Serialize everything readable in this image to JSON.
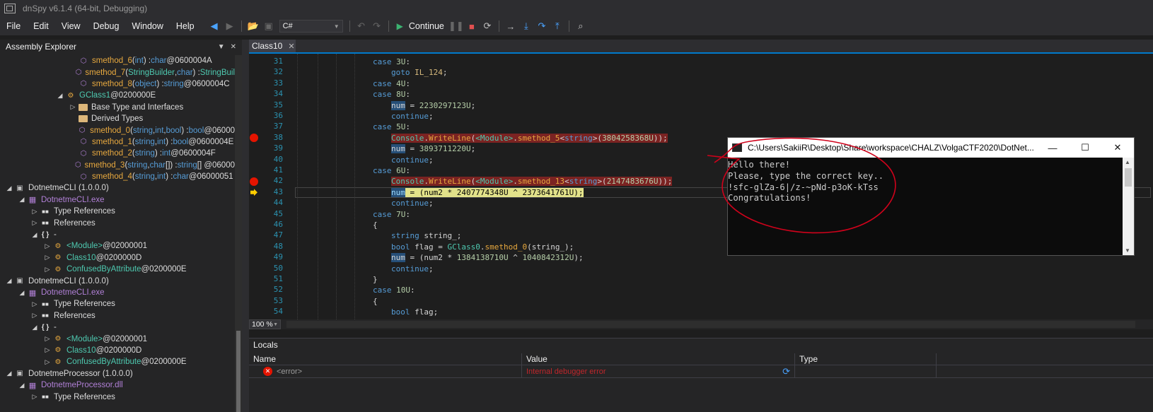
{
  "window": {
    "title": "dnSpy v6.1.4 (64-bit, Debugging)"
  },
  "menu": [
    "File",
    "Edit",
    "View",
    "Debug",
    "Window",
    "Help"
  ],
  "toolbar": {
    "language": "C#",
    "continue_label": "Continue"
  },
  "explorer": {
    "title": "Assembly Explorer",
    "rows": [
      {
        "indent": 5,
        "twisty": "",
        "icon": "method",
        "icon_name": "method-icon",
        "parts": [
          [
            "smethod_6",
            "c-method"
          ],
          [
            "(",
            "c-plain"
          ],
          [
            "int",
            "c-kw"
          ],
          [
            ") : ",
            "c-plain"
          ],
          [
            "char",
            "c-kw"
          ],
          [
            " @0600004A",
            "c-plain"
          ]
        ]
      },
      {
        "indent": 5,
        "twisty": "",
        "icon": "method",
        "icon_name": "method-icon",
        "parts": [
          [
            "smethod_7",
            "c-method"
          ],
          [
            "(",
            "c-plain"
          ],
          [
            "StringBuilder",
            "c-type"
          ],
          [
            ", ",
            "c-plain"
          ],
          [
            "char",
            "c-kw"
          ],
          [
            ") : ",
            "c-plain"
          ],
          [
            "StringBuil",
            "c-type"
          ]
        ]
      },
      {
        "indent": 5,
        "twisty": "",
        "icon": "method",
        "icon_name": "method-icon",
        "parts": [
          [
            "smethod_8",
            "c-method"
          ],
          [
            "(",
            "c-plain"
          ],
          [
            "object",
            "c-kw"
          ],
          [
            ") : ",
            "c-plain"
          ],
          [
            "string",
            "c-kw"
          ],
          [
            " @0600004C",
            "c-plain"
          ]
        ]
      },
      {
        "indent": 4,
        "twisty": "◢",
        "icon": "class",
        "icon_name": "class-icon",
        "parts": [
          [
            "GClass1",
            "c-type"
          ],
          [
            " @0200000E",
            "c-plain"
          ]
        ]
      },
      {
        "indent": 5,
        "twisty": "▷",
        "icon": "folder",
        "icon_name": "folder-icon",
        "parts": [
          [
            "Base Type and Interfaces",
            "c-plain"
          ]
        ]
      },
      {
        "indent": 5,
        "twisty": "",
        "icon": "folder",
        "icon_name": "folder-icon",
        "parts": [
          [
            "Derived Types",
            "c-plain"
          ]
        ]
      },
      {
        "indent": 5,
        "twisty": "",
        "icon": "method",
        "icon_name": "method-icon",
        "parts": [
          [
            "smethod_0",
            "c-method"
          ],
          [
            "(",
            "c-plain"
          ],
          [
            "string",
            "c-kw"
          ],
          [
            ", ",
            "c-plain"
          ],
          [
            "int",
            "c-kw"
          ],
          [
            ", ",
            "c-plain"
          ],
          [
            "bool",
            "c-kw"
          ],
          [
            ") : ",
            "c-plain"
          ],
          [
            "bool",
            "c-kw"
          ],
          [
            " @06000",
            "c-plain"
          ]
        ]
      },
      {
        "indent": 5,
        "twisty": "",
        "icon": "method",
        "icon_name": "method-icon",
        "parts": [
          [
            "smethod_1",
            "c-method"
          ],
          [
            "(",
            "c-plain"
          ],
          [
            "string",
            "c-kw"
          ],
          [
            ", ",
            "c-plain"
          ],
          [
            "int",
            "c-kw"
          ],
          [
            ") : ",
            "c-plain"
          ],
          [
            "bool",
            "c-kw"
          ],
          [
            " @0600004E",
            "c-plain"
          ]
        ]
      },
      {
        "indent": 5,
        "twisty": "",
        "icon": "method",
        "icon_name": "method-icon",
        "parts": [
          [
            "smethod_2",
            "c-method"
          ],
          [
            "(",
            "c-plain"
          ],
          [
            "string",
            "c-kw"
          ],
          [
            ") : ",
            "c-plain"
          ],
          [
            "int",
            "c-kw"
          ],
          [
            " @0600004F",
            "c-plain"
          ]
        ]
      },
      {
        "indent": 5,
        "twisty": "",
        "icon": "method",
        "icon_name": "method-icon",
        "parts": [
          [
            "smethod_3",
            "c-method"
          ],
          [
            "(",
            "c-plain"
          ],
          [
            "string",
            "c-kw"
          ],
          [
            ", ",
            "c-plain"
          ],
          [
            "char",
            "c-kw"
          ],
          [
            "[]) : ",
            "c-plain"
          ],
          [
            "string",
            "c-kw"
          ],
          [
            "[] @06000",
            "c-plain"
          ]
        ]
      },
      {
        "indent": 5,
        "twisty": "",
        "icon": "method",
        "icon_name": "method-icon",
        "parts": [
          [
            "smethod_4",
            "c-method"
          ],
          [
            "(",
            "c-plain"
          ],
          [
            "string",
            "c-kw"
          ],
          [
            ", ",
            "c-plain"
          ],
          [
            "int",
            "c-kw"
          ],
          [
            ") : ",
            "c-plain"
          ],
          [
            "char",
            "c-kw"
          ],
          [
            " @06000051",
            "c-plain"
          ]
        ]
      },
      {
        "indent": 0,
        "twisty": "◢",
        "icon": "asm",
        "icon_name": "assembly-icon",
        "parts": [
          [
            "DotnetmeCLI (1.0.0.0)",
            "c-plain"
          ]
        ]
      },
      {
        "indent": 1,
        "twisty": "◢",
        "icon": "module",
        "icon_name": "module-icon",
        "parts": [
          [
            "DotnetmeCLI.exe",
            "c-purple"
          ]
        ]
      },
      {
        "indent": 2,
        "twisty": "▷",
        "icon": "ref",
        "icon_name": "references-icon",
        "parts": [
          [
            "Type References",
            "c-plain"
          ]
        ]
      },
      {
        "indent": 2,
        "twisty": "▷",
        "icon": "ref",
        "icon_name": "references-icon",
        "parts": [
          [
            "References",
            "c-plain"
          ]
        ]
      },
      {
        "indent": 2,
        "twisty": "◢",
        "icon": "ns",
        "icon_name": "namespace-icon",
        "parts": [
          [
            "-",
            "c-plain"
          ]
        ]
      },
      {
        "indent": 3,
        "twisty": "▷",
        "icon": "class",
        "icon_name": "class-icon",
        "parts": [
          [
            "<Module>",
            "c-type"
          ],
          [
            " @02000001",
            "c-plain"
          ]
        ]
      },
      {
        "indent": 3,
        "twisty": "▷",
        "icon": "class",
        "icon_name": "class-icon",
        "parts": [
          [
            "Class10",
            "c-type"
          ],
          [
            " @0200000D",
            "c-plain"
          ]
        ]
      },
      {
        "indent": 3,
        "twisty": "▷",
        "icon": "class",
        "icon_name": "class-icon",
        "parts": [
          [
            "ConfusedByAttribute",
            "c-type"
          ],
          [
            " @0200000E",
            "c-plain"
          ]
        ]
      },
      {
        "indent": 0,
        "twisty": "◢",
        "icon": "asm",
        "icon_name": "assembly-icon",
        "parts": [
          [
            "DotnetmeCLI (1.0.0.0)",
            "c-plain"
          ]
        ]
      },
      {
        "indent": 1,
        "twisty": "◢",
        "icon": "module",
        "icon_name": "module-icon",
        "parts": [
          [
            "DotnetmeCLI.exe",
            "c-purple"
          ]
        ]
      },
      {
        "indent": 2,
        "twisty": "▷",
        "icon": "ref",
        "icon_name": "references-icon",
        "parts": [
          [
            "Type References",
            "c-plain"
          ]
        ]
      },
      {
        "indent": 2,
        "twisty": "▷",
        "icon": "ref",
        "icon_name": "references-icon",
        "parts": [
          [
            "References",
            "c-plain"
          ]
        ]
      },
      {
        "indent": 2,
        "twisty": "◢",
        "icon": "ns",
        "icon_name": "namespace-icon",
        "parts": [
          [
            "-",
            "c-plain"
          ]
        ]
      },
      {
        "indent": 3,
        "twisty": "▷",
        "icon": "class",
        "icon_name": "class-icon",
        "parts": [
          [
            "<Module>",
            "c-type"
          ],
          [
            " @02000001",
            "c-plain"
          ]
        ]
      },
      {
        "indent": 3,
        "twisty": "▷",
        "icon": "class",
        "icon_name": "class-icon",
        "parts": [
          [
            "Class10",
            "c-type"
          ],
          [
            " @0200000D",
            "c-plain"
          ]
        ]
      },
      {
        "indent": 3,
        "twisty": "▷",
        "icon": "class",
        "icon_name": "class-icon",
        "parts": [
          [
            "ConfusedByAttribute",
            "c-type"
          ],
          [
            " @0200000E",
            "c-plain"
          ]
        ]
      },
      {
        "indent": 0,
        "twisty": "◢",
        "icon": "asm",
        "icon_name": "assembly-icon",
        "parts": [
          [
            "DotnetmeProcessor (1.0.0.0)",
            "c-plain"
          ]
        ]
      },
      {
        "indent": 1,
        "twisty": "◢",
        "icon": "module",
        "icon_name": "module-icon",
        "parts": [
          [
            "DotnetmeProcessor.dll",
            "c-purple"
          ]
        ]
      },
      {
        "indent": 2,
        "twisty": "▷",
        "icon": "ref",
        "icon_name": "references-icon",
        "parts": [
          [
            "Type References",
            "c-plain"
          ]
        ]
      }
    ]
  },
  "editor": {
    "tab_label": "Class10",
    "first_line": 31,
    "lines": [
      {
        "n": 31,
        "indent": 0,
        "html": "<span class=\"k\">case</span> <span class=\"n\">3U</span>:"
      },
      {
        "n": 32,
        "indent": 1,
        "html": "<span class=\"k\">goto</span> <span class=\"lbl\">IL_124</span>;"
      },
      {
        "n": 33,
        "indent": 0,
        "html": "<span class=\"k\">case</span> <span class=\"n\">4U</span>:"
      },
      {
        "n": 34,
        "indent": 0,
        "html": "<span class=\"k\">case</span> <span class=\"n\">8U</span>:"
      },
      {
        "n": 35,
        "indent": 1,
        "html": "<span class=\"hl-sel\">num</span> = <span class=\"n\">2230297123U</span>;"
      },
      {
        "n": 36,
        "indent": 1,
        "html": "<span class=\"k\">continue</span>;"
      },
      {
        "n": 37,
        "indent": 0,
        "html": "<span class=\"k\">case</span> <span class=\"n\">5U</span>:"
      },
      {
        "n": 38,
        "indent": 1,
        "bp": true,
        "html": "<span class=\"hl-red\"><span class=\"t\">Console</span>.<span class=\"m\">WriteLine</span>(<span class=\"t\">&lt;Module&gt;</span>.<span class=\"m\">smethod_5</span>&lt;<span class=\"k\">string</span>&gt;(<span class=\"n\">3804258368U</span>));</span>"
      },
      {
        "n": 39,
        "indent": 1,
        "html": "<span class=\"hl-sel\">num</span> = <span class=\"n\">3893711220U</span>;"
      },
      {
        "n": 40,
        "indent": 1,
        "html": "<span class=\"k\">continue</span>;"
      },
      {
        "n": 41,
        "indent": 0,
        "html": "<span class=\"k\">case</span> <span class=\"n\">6U</span>:"
      },
      {
        "n": 42,
        "indent": 1,
        "bp": true,
        "html": "<span class=\"hl-red\"><span class=\"t\">Console</span>.<span class=\"m\">WriteLine</span>(<span class=\"t\">&lt;Module&gt;</span>.<span class=\"m\">smethod_13</span>&lt;<span class=\"k\">string</span>&gt;(<span class=\"n\">2147483676U</span>));</span>"
      },
      {
        "n": 43,
        "indent": 1,
        "cur": true,
        "html": "<span class=\"hl-yellow\"><span style=\"background:#264f78;color:#9cdcfe\">num</span> = (num2 * 2407774348U ^ 2373641761U);</span>"
      },
      {
        "n": 44,
        "indent": 1,
        "html": "<span class=\"k\">continue</span>;"
      },
      {
        "n": 45,
        "indent": 0,
        "html": "<span class=\"k\">case</span> <span class=\"n\">7U</span>:"
      },
      {
        "n": 46,
        "indent": 0,
        "html": "{"
      },
      {
        "n": 47,
        "indent": 1,
        "html": "<span class=\"k\">string</span> string_;"
      },
      {
        "n": 48,
        "indent": 1,
        "html": "<span class=\"k\">bool</span> flag = <span class=\"t\">GClass0</span>.<span class=\"m\">smethod_0</span>(string_);"
      },
      {
        "n": 49,
        "indent": 1,
        "html": "<span class=\"hl-sel\">num</span> = (num2 * <span class=\"n\">1384138710U</span> ^ <span class=\"n\">1040842312U</span>);"
      },
      {
        "n": 50,
        "indent": 1,
        "html": "<span class=\"k\">continue</span>;"
      },
      {
        "n": 51,
        "indent": 0,
        "html": "}"
      },
      {
        "n": 52,
        "indent": 0,
        "html": "<span class=\"k\">case</span> <span class=\"n\">10U</span>:"
      },
      {
        "n": 53,
        "indent": 0,
        "html": "{"
      },
      {
        "n": 54,
        "indent": 1,
        "html": "<span class=\"k\">bool</span> flag;"
      }
    ]
  },
  "zoom": {
    "value": "100 %"
  },
  "locals": {
    "title": "Locals",
    "columns": [
      "Name",
      "Value",
      "Type"
    ],
    "row": {
      "name": "<error>",
      "value": "Internal debugger error",
      "type": ""
    }
  },
  "console": {
    "title": "C:\\Users\\SakiiR\\Desktop\\Share\\workspace\\CHALZ\\VolgaCTF2020\\DotNet...",
    "lines": [
      "Hello there!",
      "Please, type the correct key..",
      "!sfc-glZa-6|/z-~pNd-p3oK-kTss",
      "Congratulations!"
    ]
  },
  "colors": {
    "accent": "#007acc",
    "breakpoint": "#e51400",
    "current_line": "#e2e28a",
    "annotation": "#d0021b"
  }
}
